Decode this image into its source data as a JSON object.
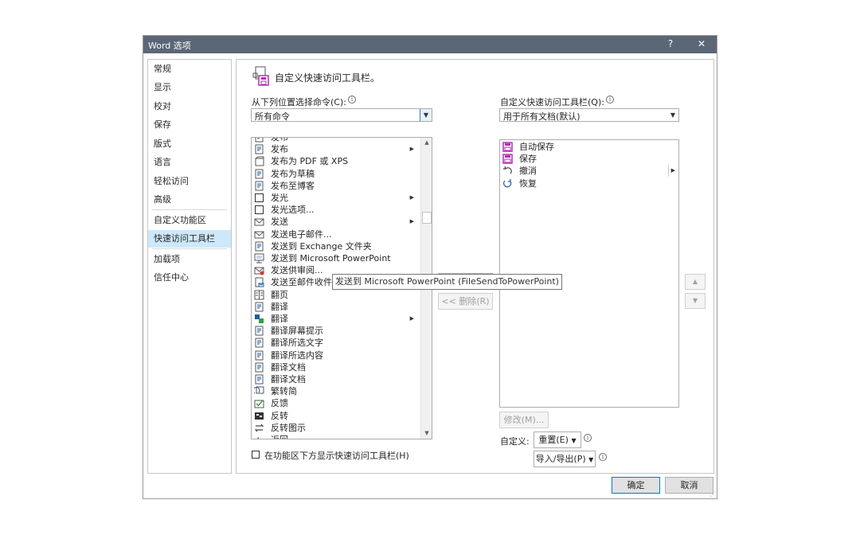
{
  "window": {
    "title": "Word 选项",
    "help": "?",
    "close": "✕"
  },
  "sidebar": {
    "items": [
      {
        "label": "常规"
      },
      {
        "label": "显示"
      },
      {
        "label": "校对"
      },
      {
        "label": "保存"
      },
      {
        "label": "版式"
      },
      {
        "label": "语言"
      },
      {
        "label": "轻松访问"
      },
      {
        "label": "高级"
      },
      {
        "label": "自定义功能区"
      },
      {
        "label": "快速访问工具栏",
        "selected": true
      },
      {
        "label": "加载项"
      },
      {
        "label": "信任中心"
      }
    ]
  },
  "main": {
    "heading": "自定义快速访问工具栏。",
    "choose_from_label": "从下列位置选择命令(C):",
    "choose_from_value": "所有命令",
    "customize_label": "自定义快速访问工具栏(Q):",
    "customize_value": "用于所有文档(默认)",
    "commands": [
      {
        "label": "发布",
        "icon": "publish-icon"
      },
      {
        "label": "发布",
        "icon": "publish-icon",
        "submenu": true
      },
      {
        "label": "发布为 PDF 或 XPS",
        "icon": "pdf-icon"
      },
      {
        "label": "发布为草稿",
        "icon": "draft-icon"
      },
      {
        "label": "发布至博客",
        "icon": "blog-icon"
      },
      {
        "label": "发光",
        "icon": "glow-icon",
        "submenu": true
      },
      {
        "label": "发光选项...",
        "icon": "glow-options-icon"
      },
      {
        "label": "发送",
        "icon": "send-icon",
        "submenu": true
      },
      {
        "label": "发送电子邮件...",
        "icon": "email-icon"
      },
      {
        "label": "发送到 Exchange 文件夹",
        "icon": "exchange-icon"
      },
      {
        "label": "发送到 Microsoft PowerPoint",
        "icon": "powerpoint-icon"
      },
      {
        "label": "发送供审阅...",
        "icon": "review-icon"
      },
      {
        "label": "发送至邮件收件人",
        "icon": "mail-recipient-icon"
      },
      {
        "label": "翻页",
        "icon": "page-flip-icon"
      },
      {
        "label": "翻译",
        "icon": "translate-icon"
      },
      {
        "label": "翻译",
        "icon": "translate-menu-icon",
        "submenu": true
      },
      {
        "label": "翻译屏幕提示",
        "icon": "translate-tip-icon"
      },
      {
        "label": "翻译所选文字",
        "icon": "translate-text-icon"
      },
      {
        "label": "翻译所选内容",
        "icon": "translate-selection-icon"
      },
      {
        "label": "翻译文档",
        "icon": "translate-doc-icon"
      },
      {
        "label": "翻译文档",
        "icon": "translate-doc-icon"
      },
      {
        "label": "繁转简",
        "icon": "trad-simp-icon"
      },
      {
        "label": "反馈",
        "icon": "feedback-icon"
      },
      {
        "label": "反转",
        "icon": "invert-icon"
      },
      {
        "label": "反转图示",
        "icon": "reverse-diagram-icon"
      },
      {
        "label": "返回",
        "icon": "back-icon"
      }
    ],
    "toolbar_items": [
      {
        "label": "自动保存",
        "icon": "autosave-icon"
      },
      {
        "label": "保存",
        "icon": "save-icon"
      },
      {
        "label": "撤消",
        "icon": "undo-icon",
        "submenu": true
      },
      {
        "label": "恢复",
        "icon": "redo-icon"
      }
    ],
    "tooltip": "发送到 Microsoft PowerPoint (FileSendToPowerPoint)",
    "remove_button": "<< 删除(R)",
    "modify_button": "修改(M)...",
    "customize_text": "自定义:",
    "reset_button": "重置(E)",
    "import_export_button": "导入/导出(P)",
    "show_below_ribbon": "在功能区下方显示快速访问工具栏(H)",
    "move_up": "▲",
    "move_down": "▼"
  },
  "footer": {
    "ok": "确定",
    "cancel": "取消"
  },
  "colors": {
    "titlebar": "#5b6776",
    "selected": "#cde8fb",
    "accent": "#0078d7",
    "icon_blue": "#1e5aa8",
    "icon_purple": "#b22fb7"
  }
}
